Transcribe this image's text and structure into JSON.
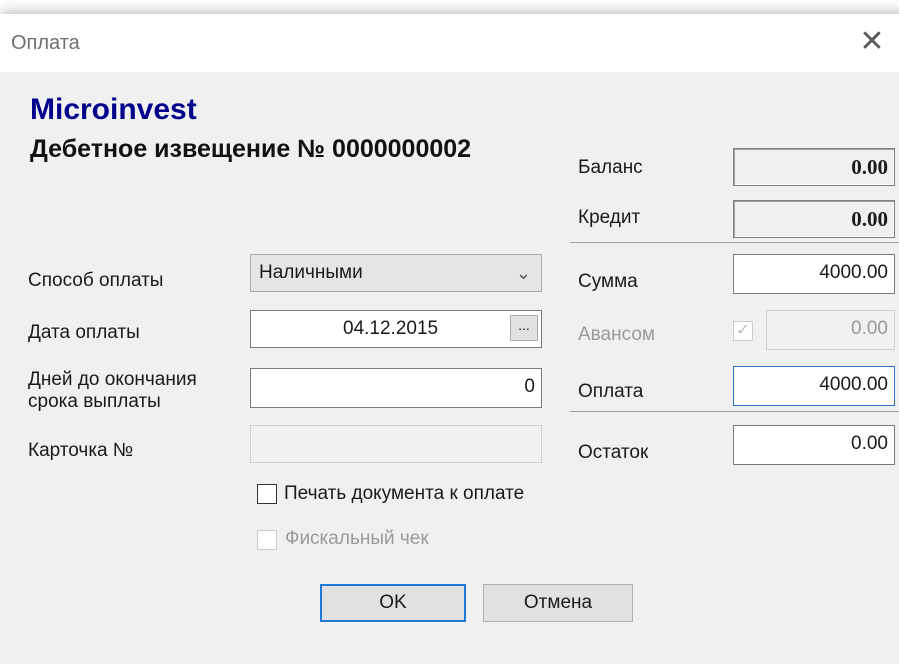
{
  "window": {
    "title": "Оплата"
  },
  "header": {
    "brand": "Microinvest",
    "document_title": "Дебетное извещение № 0000000002"
  },
  "form": {
    "payment_method": {
      "label": "Способ оплаты",
      "value": "Наличными"
    },
    "payment_date": {
      "label": "Дата оплаты",
      "value": "04.12.2015",
      "button_label": "..."
    },
    "days_until_due": {
      "label": "Дней до окончания срока выплаты",
      "value": "0"
    },
    "card_number": {
      "label": "Карточка №",
      "value": ""
    }
  },
  "summary": {
    "balance": {
      "label": "Баланс",
      "value": "0.00"
    },
    "credit": {
      "label": "Кредит",
      "value": "0.00"
    },
    "amount": {
      "label": "Сумма",
      "value": "4000.00"
    },
    "advance": {
      "label": "Авансом",
      "value": "0.00",
      "checked": true
    },
    "payment": {
      "label": "Оплата",
      "value": "4000.00"
    },
    "remainder": {
      "label": "Остаток",
      "value": "0.00"
    }
  },
  "options": {
    "print_document": {
      "label": "Печать документа к оплате",
      "checked": false
    },
    "fiscal_receipt": {
      "label": "Фискальный чек",
      "checked": false,
      "enabled": false
    }
  },
  "buttons": {
    "ok": "OK",
    "cancel": "Отмена"
  },
  "icons": {
    "close": "close-icon",
    "dropdown": "chevron-down-icon",
    "check": "check-icon"
  },
  "colors": {
    "brand": "#00008b",
    "focus": "#2b73c9",
    "default_button": "#1e7ad6"
  }
}
